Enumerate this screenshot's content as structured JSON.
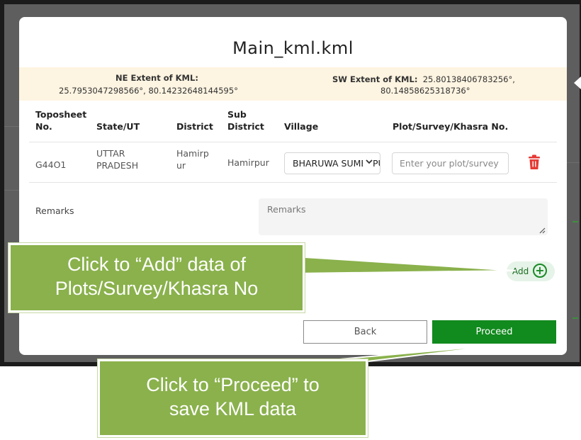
{
  "modal": {
    "title": "Main_kml.kml",
    "ne_label": "NE Extent of KML:",
    "ne_value": "25.7953047298566°, 80.14232648144595°",
    "sw_label": "SW Extent of KML:",
    "sw_value_line1": "25.80138406783256°,",
    "sw_value_line2": "80.14858625318736°"
  },
  "table": {
    "headers": {
      "toposheet": [
        "Toposheet",
        "No."
      ],
      "state": "State/UT",
      "district": "District",
      "sub_district": [
        "Sub",
        "District"
      ],
      "village": "Village",
      "plot": "Plot/Survey/Khasra No."
    },
    "row": {
      "toposheet": "G44O1",
      "state": [
        "UTTAR",
        "PRADESH"
      ],
      "district": [
        "Hamirp",
        "ur"
      ],
      "sub_district": "Hamirpur",
      "village": "BHARUWA SUMERPUR",
      "plot_placeholder": "Enter your plot/survey"
    }
  },
  "remarks": {
    "label": "Remarks",
    "placeholder": "Remarks"
  },
  "buttons": {
    "add": "Add",
    "back": "Back",
    "proceed": "Proceed"
  },
  "callouts": {
    "add_line1": "Click to “Add” data of",
    "add_line2": "Plots/Survey/Khasra No",
    "proceed_line1": "Click to “Proceed” to",
    "proceed_line2": "save KML data"
  },
  "colors": {
    "primary_green": "#118a1e",
    "delete_red": "#e53935",
    "extent_bg": "#fdf4e1",
    "callout_green": "#8ab14c"
  },
  "icons": {
    "delete": "trash-icon",
    "add": "plus-circle-icon",
    "dropdown": "chevron-down-icon"
  }
}
